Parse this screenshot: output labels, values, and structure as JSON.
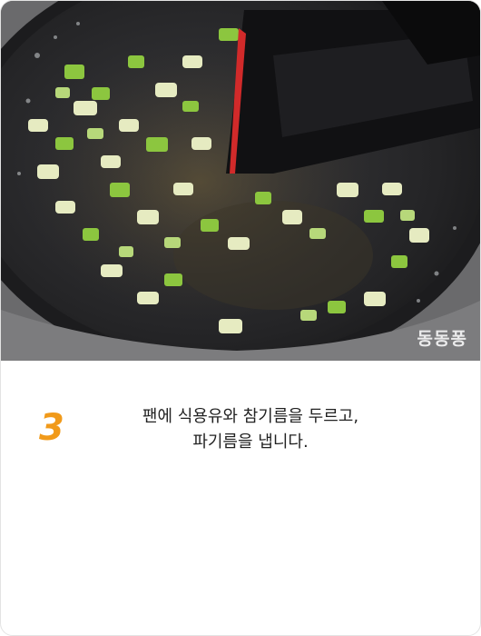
{
  "photo": {
    "alt_subject": "pan-with-sauteed-green-onions",
    "watermark": "동동퐁"
  },
  "step": {
    "number": "3",
    "line1": "팬에 식용유와 참기름을 두르고,",
    "line2": "파기름을 냅니다."
  },
  "colors": {
    "step_number": "#f19a1a",
    "pan": "#2a2a2c",
    "onion_green": "#8cc63f",
    "onion_pale": "#e8ecc0"
  }
}
